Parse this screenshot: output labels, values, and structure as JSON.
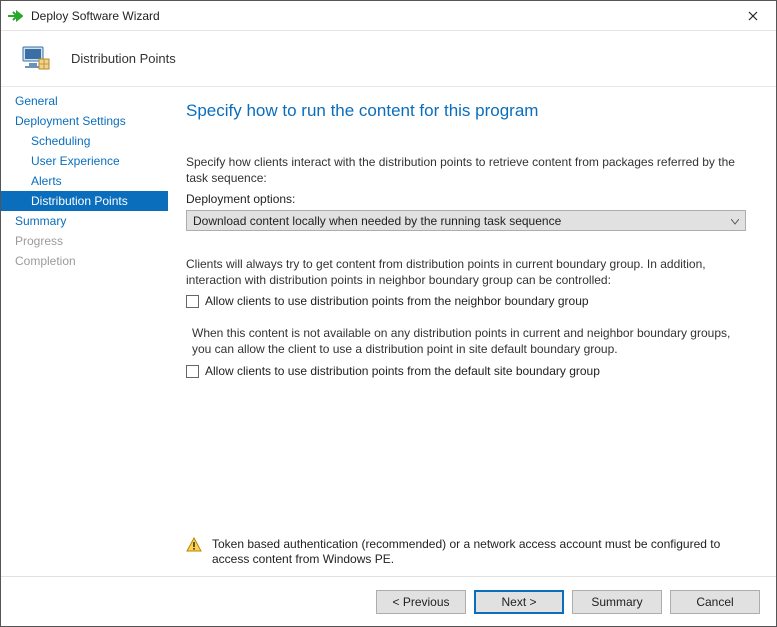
{
  "window": {
    "title": "Deploy Software Wizard"
  },
  "header": {
    "page_name": "Distribution Points"
  },
  "sidebar": {
    "items": [
      {
        "label": "General"
      },
      {
        "label": "Deployment Settings"
      },
      {
        "label": "Scheduling"
      },
      {
        "label": "User Experience"
      },
      {
        "label": "Alerts"
      },
      {
        "label": "Distribution Points"
      },
      {
        "label": "Summary"
      },
      {
        "label": "Progress"
      },
      {
        "label": "Completion"
      }
    ]
  },
  "main": {
    "title": "Specify how to run the content for this program",
    "intro": "Specify how clients interact with the distribution points to retrieve content from packages referred by the task sequence:",
    "deploy_label": "Deployment options:",
    "deploy_value": "Download content locally when needed by the running task sequence",
    "boundary_text": "Clients will always try to get content from distribution points in current boundary group. In addition, interaction with distribution points in neighbor boundary group can be controlled:",
    "cb_neighbor": "Allow clients to use distribution points from the neighbor boundary group",
    "fallback_text": "When this content is not available on any distribution points in current and neighbor boundary groups, you can allow the client to use a distribution point in site default boundary group.",
    "cb_default": "Allow clients to use distribution points from the default site boundary group",
    "warning": "Token based authentication (recommended) or a network access account must be configured to access content from Windows PE."
  },
  "footer": {
    "previous": "< Previous",
    "next": "Next >",
    "summary": "Summary",
    "cancel": "Cancel"
  }
}
